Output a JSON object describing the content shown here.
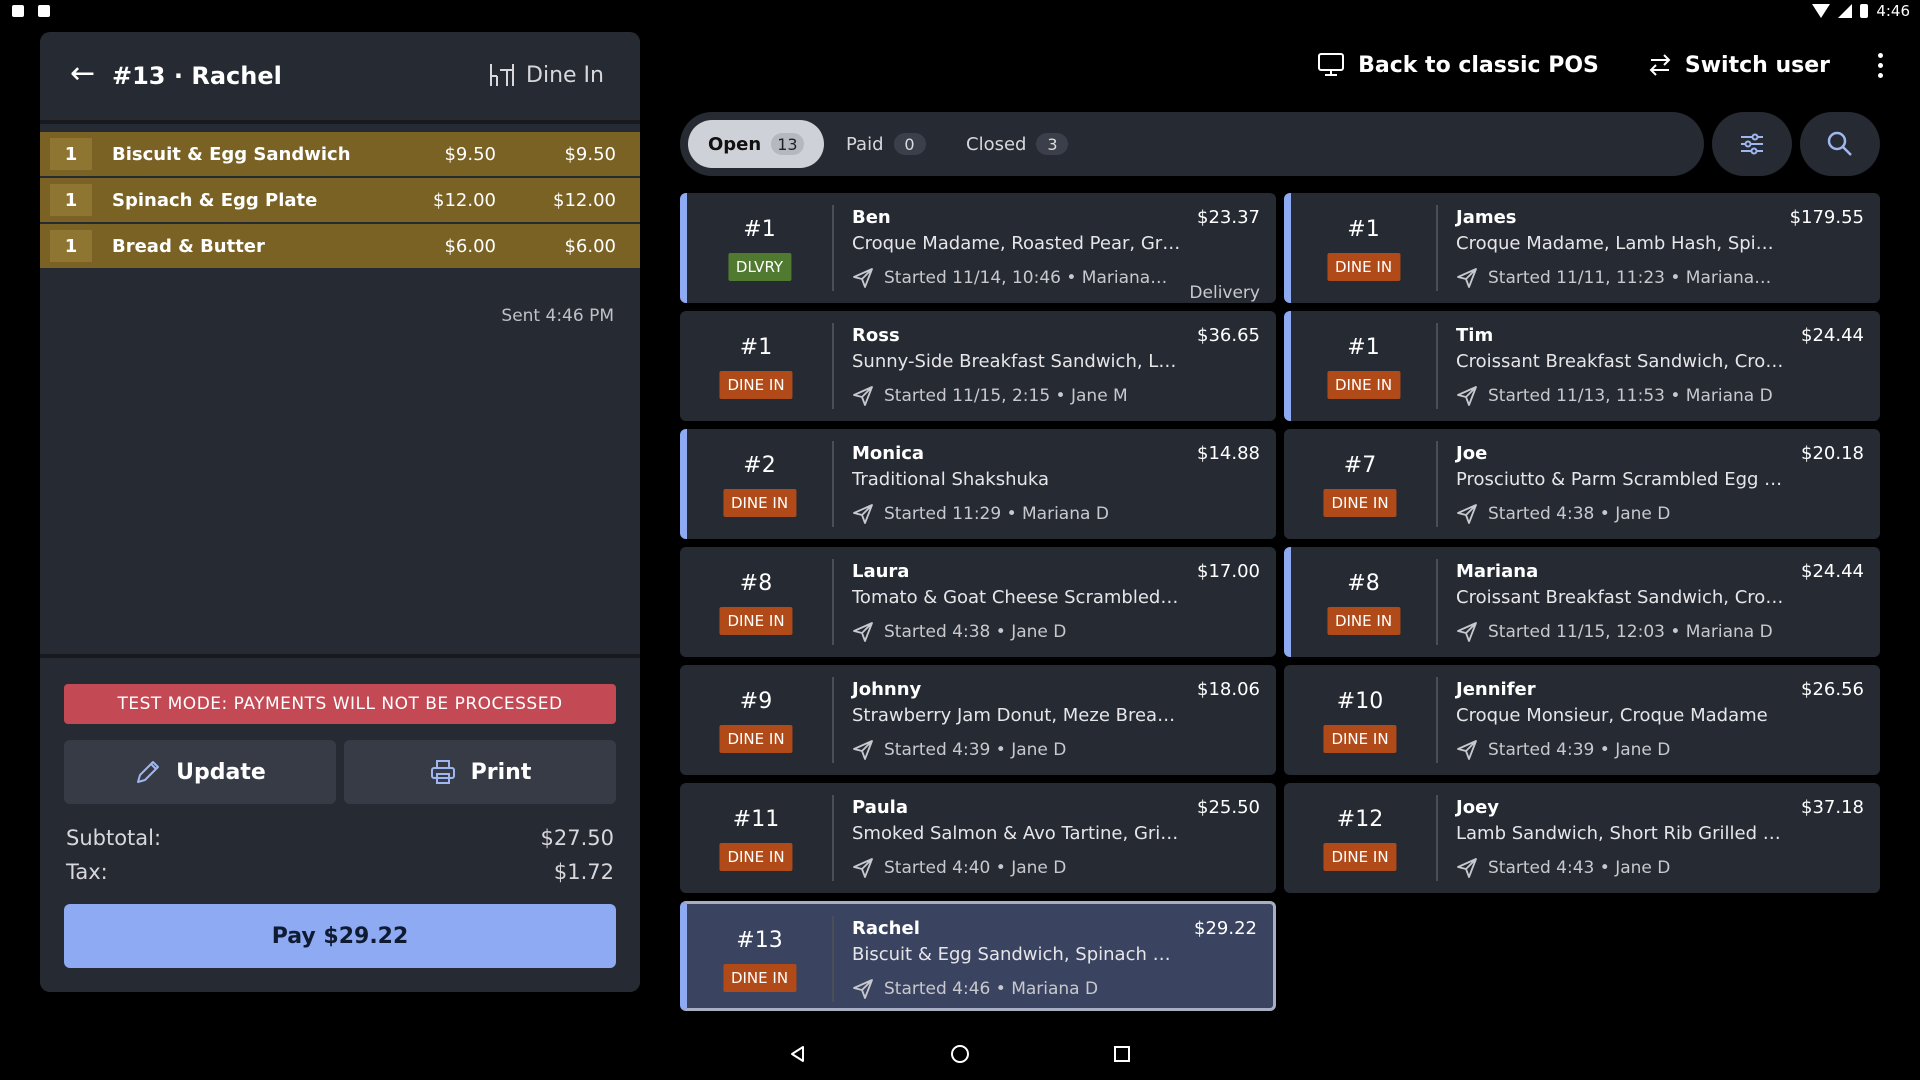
{
  "status_bar": {
    "time": "4:46"
  },
  "order": {
    "title": "#13 · Rachel",
    "type": "Dine In",
    "items": [
      {
        "qty": "1",
        "name": "Biscuit & Egg Sandwich",
        "price": "$9.50",
        "total": "$9.50"
      },
      {
        "qty": "1",
        "name": "Spinach & Egg Plate",
        "price": "$12.00",
        "total": "$12.00"
      },
      {
        "qty": "1",
        "name": "Bread & Butter",
        "price": "$6.00",
        "total": "$6.00"
      }
    ],
    "sent": "Sent 4:46 PM",
    "test_mode": "TEST MODE:  PAYMENTS WILL NOT BE PROCESSED",
    "update_label": "Update",
    "print_label": "Print",
    "subtotal_label": "Subtotal:",
    "subtotal": "$27.50",
    "tax_label": "Tax:",
    "tax": "$1.72",
    "pay_label": "Pay $29.22"
  },
  "top_actions": {
    "back_classic": "Back to classic POS",
    "switch_user": "Switch user"
  },
  "filters": [
    {
      "label": "Open",
      "count": "13"
    },
    {
      "label": "Paid",
      "count": "0"
    },
    {
      "label": "Closed",
      "count": "3"
    }
  ],
  "cards": [
    {
      "num": "#1",
      "badge": "DLVRY",
      "name": "Ben",
      "amount": "$23.37",
      "items": "Croque Madame, Roasted Pear, Gr…",
      "meta": "Started 11/14, 10:46 • Mariana…",
      "channel": "Delivery"
    },
    {
      "num": "#1",
      "badge": "DINE IN",
      "name": "James",
      "amount": "$179.55",
      "items": "Croque Madame, Lamb Hash, Spi…",
      "meta": "Started 11/11, 11:23 • Mariana…",
      "channel": ""
    },
    {
      "num": "#1",
      "badge": "DINE IN",
      "name": "Ross",
      "amount": "$36.65",
      "items": "Sunny-Side Breakfast Sandwich, La…",
      "meta": "Started 11/15, 2:15 • Jane M",
      "channel": ""
    },
    {
      "num": "#1",
      "badge": "DINE IN",
      "name": "Tim",
      "amount": "$24.44",
      "items": "Croissant Breakfast Sandwich, Cro…",
      "meta": "Started 11/13, 11:53 • Mariana D",
      "channel": ""
    },
    {
      "num": "#2",
      "badge": "DINE IN",
      "name": "Monica",
      "amount": "$14.88",
      "items": "Traditional Shakshuka",
      "meta": "Started 11:29 • Mariana D",
      "channel": ""
    },
    {
      "num": "#7",
      "badge": "DINE IN",
      "name": "Joe",
      "amount": "$20.18",
      "items": "Prosciutto & Parm Scrambled Egg P…",
      "meta": "Started 4:38 • Jane D",
      "channel": ""
    },
    {
      "num": "#8",
      "badge": "DINE IN",
      "name": "Laura",
      "amount": "$17.00",
      "items": "Tomato & Goat Cheese Scrambled …",
      "meta": "Started 4:38 • Jane D",
      "channel": ""
    },
    {
      "num": "#8",
      "badge": "DINE IN",
      "name": "Mariana",
      "amount": "$24.44",
      "items": "Croissant Breakfast Sandwich, Cro…",
      "meta": "Started 11/15, 12:03 • Mariana D",
      "channel": ""
    },
    {
      "num": "#9",
      "badge": "DINE IN",
      "name": "Johnny",
      "amount": "$18.06",
      "items": "Strawberry Jam Donut, Meze Break…",
      "meta": "Started 4:39 • Jane D",
      "channel": ""
    },
    {
      "num": "#10",
      "badge": "DINE IN",
      "name": "Jennifer",
      "amount": "$26.56",
      "items": "Croque Monsieur, Croque Madame",
      "meta": "Started 4:39 • Jane D",
      "channel": ""
    },
    {
      "num": "#11",
      "badge": "DINE IN",
      "name": "Paula",
      "amount": "$25.50",
      "items": "Smoked Salmon & Avo Tartine, Grill…",
      "meta": "Started 4:40 • Jane D",
      "channel": ""
    },
    {
      "num": "#12",
      "badge": "DINE IN",
      "name": "Joey",
      "amount": "$37.18",
      "items": "Lamb Sandwich, Short Rib Grilled C…",
      "meta": "Started 4:43 • Jane D",
      "channel": ""
    },
    {
      "num": "#13",
      "badge": "DINE IN",
      "name": "Rachel",
      "amount": "$29.22",
      "items": "Biscuit & Egg Sandwich, Spinach & …",
      "meta": "Started 4:46 • Mariana D",
      "channel": ""
    }
  ]
}
